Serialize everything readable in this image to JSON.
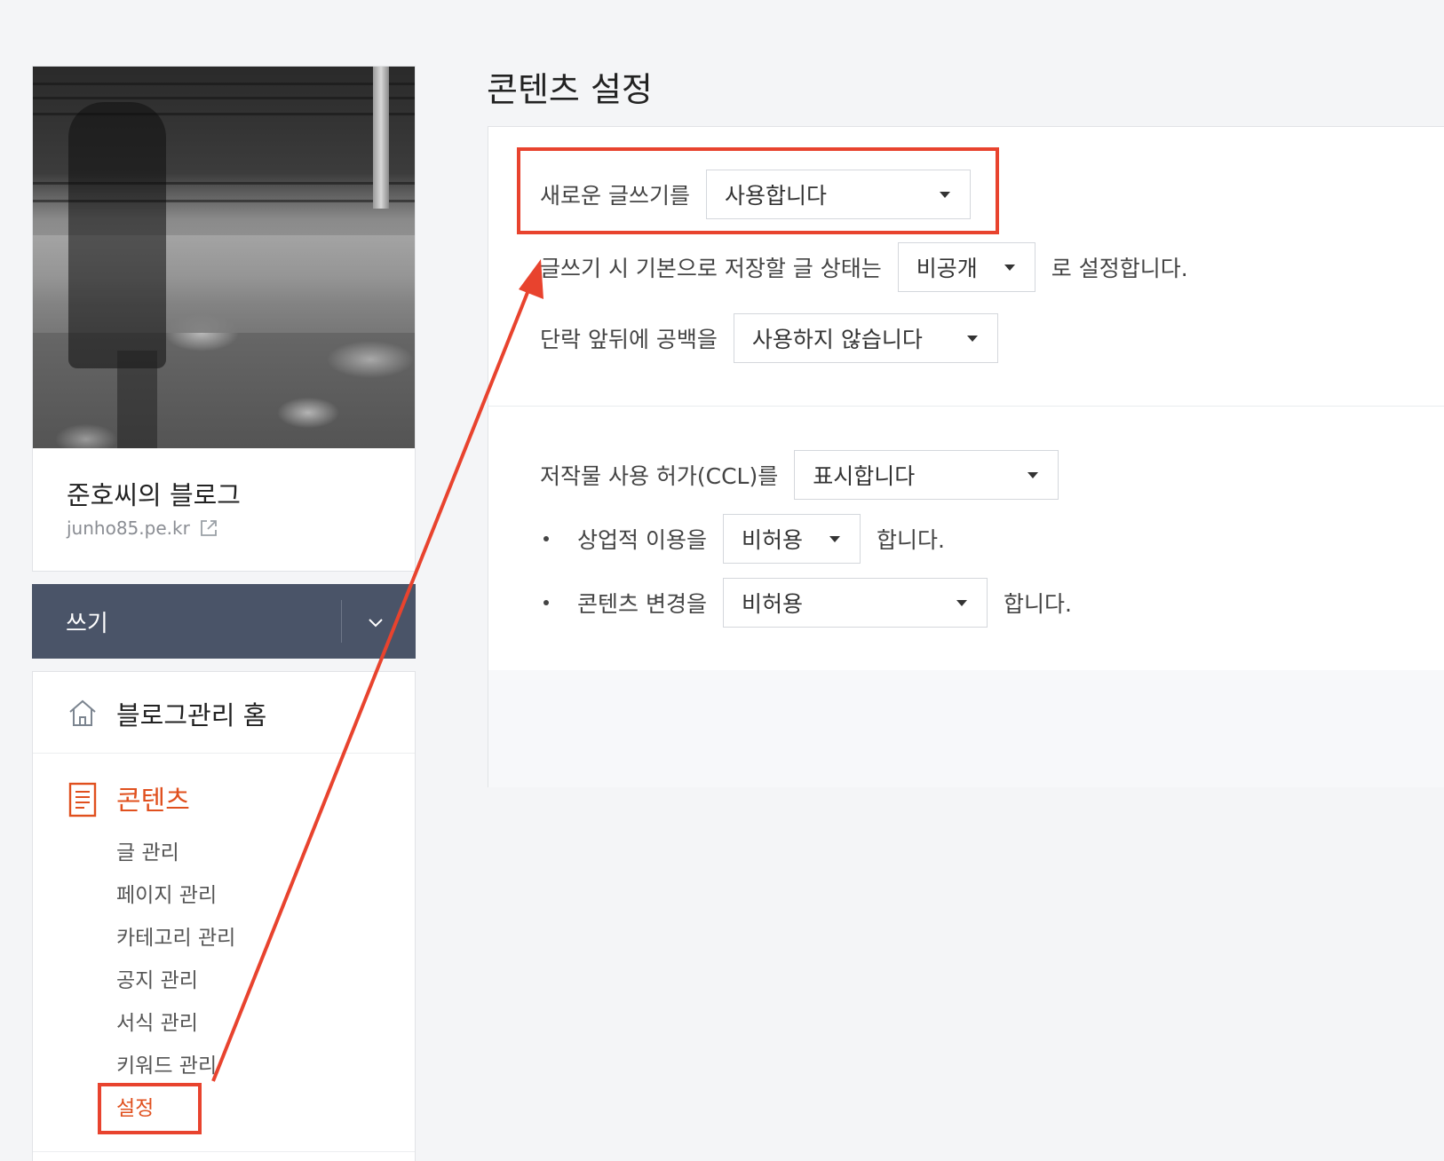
{
  "sidebar": {
    "blog_name": "준호씨의 블로그",
    "blog_url": "junho85.pe.kr",
    "write_button": "쓰기",
    "home_label": "블로그관리 홈",
    "content_section": "콘텐츠",
    "content_items": [
      "글 관리",
      "페이지 관리",
      "카테고리 관리",
      "공지 관리",
      "서식 관리",
      "키워드 관리",
      "설정"
    ]
  },
  "main": {
    "title": "콘텐츠 설정",
    "editor": {
      "label": "새로운 글쓰기를",
      "value": "사용합니다"
    },
    "default_status": {
      "label": "글쓰기 시 기본으로 저장할 글 상태는",
      "value": "비공개",
      "suffix": "로 설정합니다."
    },
    "paragraph_spacing": {
      "label": "단락 앞뒤에 공백을",
      "value": "사용하지 않습니다"
    },
    "ccl": {
      "label": "저작물 사용 허가(CCL)를",
      "value": "표시합니다"
    },
    "commercial": {
      "label": "상업적 이용을",
      "value": "비허용",
      "suffix": "합니다."
    },
    "modification": {
      "label": "콘텐츠 변경을",
      "value": "비허용",
      "suffix": "합니다."
    }
  },
  "colors": {
    "accent": "#e0501e",
    "annotation": "#e8432e",
    "write_bar": "#4a5468"
  }
}
